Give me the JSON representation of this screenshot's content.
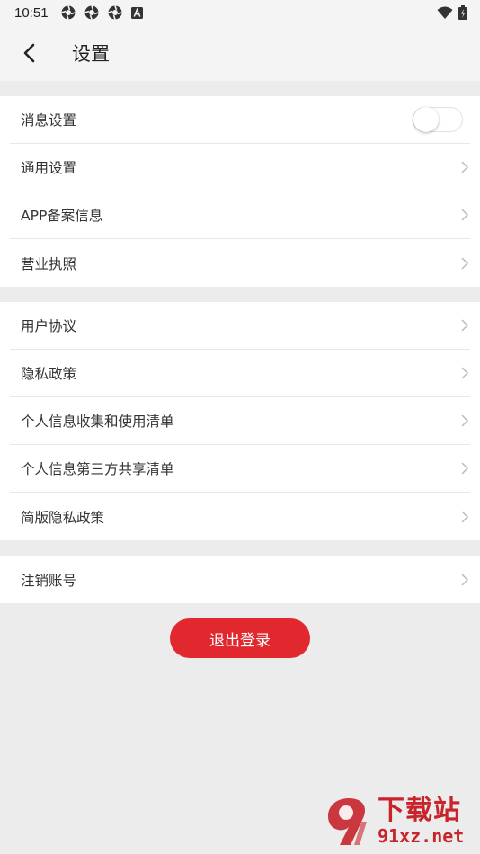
{
  "status": {
    "time": "10:51",
    "icons": [
      "aperture-icon",
      "aperture-icon",
      "aperture-icon",
      "a-badge-icon"
    ],
    "right_icons": [
      "wifi-icon",
      "battery-icon"
    ]
  },
  "topbar": {
    "title": "设置"
  },
  "groups": [
    {
      "items": [
        {
          "label": "消息设置",
          "control": "toggle",
          "on": false
        },
        {
          "label": "通用设置",
          "control": "chevron"
        },
        {
          "label": "APP备案信息",
          "control": "chevron"
        },
        {
          "label": "营业执照",
          "control": "chevron"
        }
      ]
    },
    {
      "items": [
        {
          "label": "用户协议",
          "control": "chevron"
        },
        {
          "label": "隐私政策",
          "control": "chevron"
        },
        {
          "label": "个人信息收集和使用清单",
          "control": "chevron"
        },
        {
          "label": "个人信息第三方共享清单",
          "control": "chevron"
        },
        {
          "label": "简版隐私政策",
          "control": "chevron"
        }
      ]
    },
    {
      "items": [
        {
          "label": "注销账号",
          "control": "chevron"
        }
      ]
    }
  ],
  "logout_label": "退出登录",
  "watermark": {
    "title": "下载站",
    "url": "91xz.net"
  },
  "colors": {
    "accent": "#e0282e",
    "background": "#ececec",
    "card": "#ffffff"
  }
}
